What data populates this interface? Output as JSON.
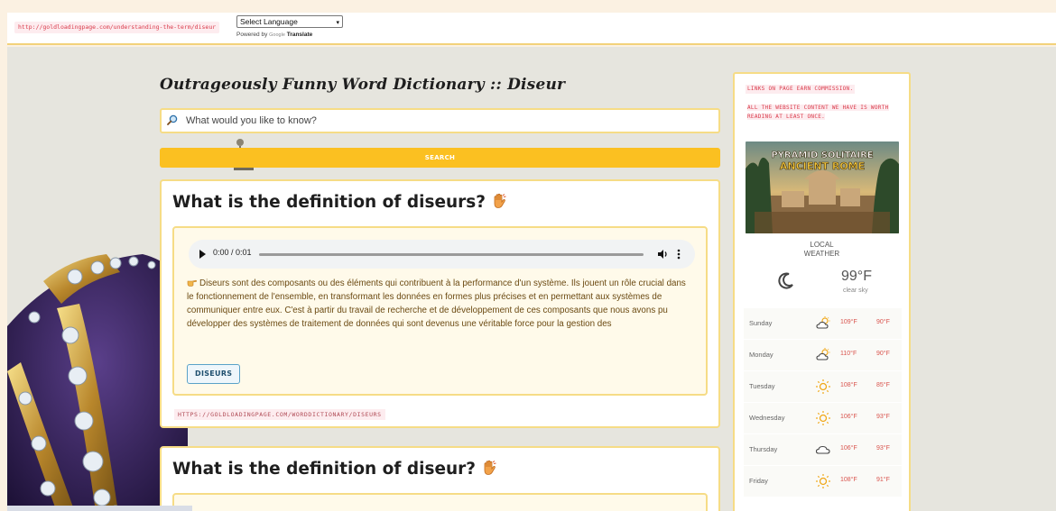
{
  "topbar": {
    "url": "http://goldloadingpage.com/understanding-the-term/diseur",
    "language_select": "Select Language",
    "powered_by": "Powered by",
    "google": "Google",
    "translate": "Translate"
  },
  "header": {
    "title": "Outrageously Funny Word Dictionary :: Diseur",
    "search_placeholder": "What would you like to know?",
    "search_button": "SEARCH"
  },
  "cards": [
    {
      "heading": "What is the definition of diseurs?",
      "audio_time": "0:00 / 0:01",
      "description": "Diseurs sont des composants ou des éléments qui contribuent à la performance d'un système. Ils jouent un rôle crucial dans le fonctionnement de l'ensemble, en transformant les données en formes plus précises et en permettant aux systèmes de communiquer entre eux. C'est à partir du travail de recherche et de développement de ces composants que nous avons pu développer des systèmes de traitement de données qui sont devenus une véritable force pour la gestion des",
      "tag": "DISEURS",
      "link": "HTTPS://GOLDLOADINGPAGE.COM/WORDDICTIONARY/DISEURS"
    },
    {
      "heading": "What is the definition of diseur?"
    }
  ],
  "sidebar": {
    "note1": "LINKS ON PAGE EARN COMMISSION.",
    "note2": "ALL THE WEBSITE CONTENT WE HAVE IS WORTH READING AT LEAST ONCE.",
    "ad_line1": "PYRAMID SOLITAIRE",
    "ad_line2": "ANCIENT ROME",
    "weather_title_1": "LOCAL",
    "weather_title_2": "WEATHER",
    "current_temp": "99°F",
    "current_condition": "clear sky",
    "current_icon": "moon-icon",
    "forecast": [
      {
        "day": "Sunday",
        "icon": "partly-cloudy-icon",
        "hi": "109°F",
        "lo": "90°F"
      },
      {
        "day": "Monday",
        "icon": "partly-cloudy-icon",
        "hi": "110°F",
        "lo": "90°F"
      },
      {
        "day": "Tuesday",
        "icon": "sun-icon",
        "hi": "108°F",
        "lo": "85°F"
      },
      {
        "day": "Wednesday",
        "icon": "sun-icon",
        "hi": "106°F",
        "lo": "93°F"
      },
      {
        "day": "Thursday",
        "icon": "cloud-icon",
        "hi": "106°F",
        "lo": "93°F"
      },
      {
        "day": "Friday",
        "icon": "sun-icon",
        "hi": "108°F",
        "lo": "91°F"
      }
    ]
  },
  "colors": {
    "accent_yellow": "#fbc021",
    "border_yellow": "#f6dc86",
    "link_red": "#d93a4a",
    "temp_red": "#d9544e"
  }
}
